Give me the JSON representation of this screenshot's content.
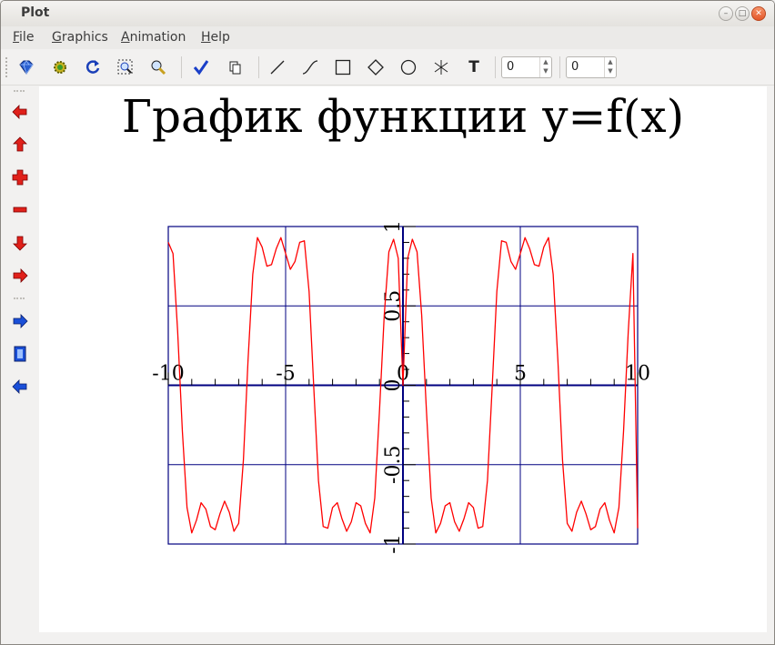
{
  "window": {
    "title": "Plot"
  },
  "menu": [
    {
      "label": "File",
      "mnemonic": "F",
      "rest": "ile"
    },
    {
      "label": "Graphics",
      "mnemonic": "G",
      "rest": "raphics"
    },
    {
      "label": "Animation",
      "mnemonic": "A",
      "rest": "nimation"
    },
    {
      "label": "Help",
      "mnemonic": "H",
      "rest": "elp"
    }
  ],
  "toolbar": {
    "tools": [
      "gem-icon",
      "gear-icon",
      "refresh-icon",
      "zoom-select-icon",
      "zoom-tool-icon",
      "checkmark-icon",
      "copy-icon",
      "line-tool-icon",
      "curve-tool-icon",
      "rectangle-tool-icon",
      "diamond-tool-icon",
      "circle-tool-icon",
      "asterisk-tool-icon",
      "text-tool-icon"
    ],
    "spin1_value": "0",
    "spin2_value": "0",
    "text_tool_label": "T"
  },
  "sidebar": {
    "items": [
      "arrow-left-icon",
      "arrow-up-icon",
      "plus-icon",
      "minus-icon",
      "arrow-down-icon",
      "arrow-right-icon",
      "play-forward-icon",
      "film-icon",
      "play-back-icon"
    ]
  },
  "colors": {
    "curve": "#ff0000",
    "grid": "#000080",
    "red_icon": "#e0201a",
    "blue_icon": "#1a4fd8"
  },
  "chart_data": {
    "type": "line",
    "title": "График функции y=f(x)",
    "xlim": [
      -10,
      10
    ],
    "ylim": [
      -1,
      1
    ],
    "x_ticks": [
      -10,
      -5,
      0,
      5,
      10
    ],
    "x_tick_labels": [
      "-10",
      "-5",
      "0",
      "5",
      "10"
    ],
    "y_ticks": [
      1,
      0.5,
      0,
      -0.5,
      -1
    ],
    "y_tick_labels": [
      "1",
      "0.5",
      "0",
      "-0.5",
      "-1"
    ],
    "grid": true,
    "series": [
      {
        "color": "#ff0000",
        "x": [
          -10.0,
          -9.8,
          -9.6,
          -9.4,
          -9.2,
          -9.0,
          -8.8,
          -8.6,
          -8.4,
          -8.2,
          -8.0,
          -7.8,
          -7.6,
          -7.4,
          -7.2,
          -7.0,
          -6.8,
          -6.6,
          -6.4,
          -6.2,
          -6.0,
          -5.8,
          -5.6,
          -5.4,
          -5.2,
          -5.0,
          -4.8,
          -4.6,
          -4.4,
          -4.2,
          -4.0,
          -3.8,
          -3.6,
          -3.4,
          -3.2,
          -3.0,
          -2.8,
          -2.6,
          -2.4,
          -2.2,
          -2.0,
          -1.8,
          -1.6,
          -1.4,
          -1.2,
          -1.0,
          -0.8,
          -0.6,
          -0.4,
          -0.2,
          0.0,
          0.2,
          0.4,
          0.6,
          0.8,
          1.0,
          1.2,
          1.4,
          1.6,
          1.8,
          2.0,
          2.2,
          2.4,
          2.6,
          2.8,
          3.0,
          3.2,
          3.4,
          3.6,
          3.8,
          4.0,
          4.2,
          4.4,
          4.6,
          4.8,
          5.0,
          5.2,
          5.4,
          5.6,
          5.8,
          6.0,
          6.2,
          6.4,
          6.6,
          6.8,
          7.0,
          7.2,
          7.4,
          7.6,
          7.8,
          8.0,
          8.2,
          8.4,
          8.6,
          8.8,
          9.0,
          9.2,
          9.4,
          9.6,
          9.8,
          10.0
        ],
        "y": [
          0.9,
          0.83,
          0.34,
          -0.29,
          -0.77,
          -0.93,
          -0.85,
          -0.74,
          -0.78,
          -0.89,
          -0.91,
          -0.81,
          -0.73,
          -0.8,
          -0.92,
          -0.87,
          -0.47,
          0.16,
          0.7,
          0.93,
          0.87,
          0.75,
          0.76,
          0.86,
          0.93,
          0.83,
          0.73,
          0.78,
          0.9,
          0.91,
          0.59,
          -0.02,
          -0.6,
          -0.89,
          -0.9,
          -0.77,
          -0.74,
          -0.84,
          -0.92,
          -0.86,
          -0.74,
          -0.76,
          -0.87,
          -0.93,
          -0.71,
          -0.16,
          0.44,
          0.84,
          0.92,
          0.8,
          0.0,
          0.8,
          0.92,
          0.84,
          0.44,
          -0.16,
          -0.71,
          -0.93,
          -0.87,
          -0.76,
          -0.74,
          -0.86,
          -0.92,
          -0.84,
          -0.74,
          -0.77,
          -0.9,
          -0.89,
          -0.6,
          -0.02,
          0.59,
          0.91,
          0.9,
          0.78,
          0.73,
          0.83,
          0.93,
          0.86,
          0.76,
          0.75,
          0.87,
          0.93,
          0.7,
          0.16,
          -0.47,
          -0.87,
          -0.92,
          -0.8,
          -0.73,
          -0.81,
          -0.91,
          -0.89,
          -0.78,
          -0.74,
          -0.85,
          -0.93,
          -0.77,
          -0.29,
          0.34,
          0.83,
          -0.9
        ]
      }
    ]
  }
}
